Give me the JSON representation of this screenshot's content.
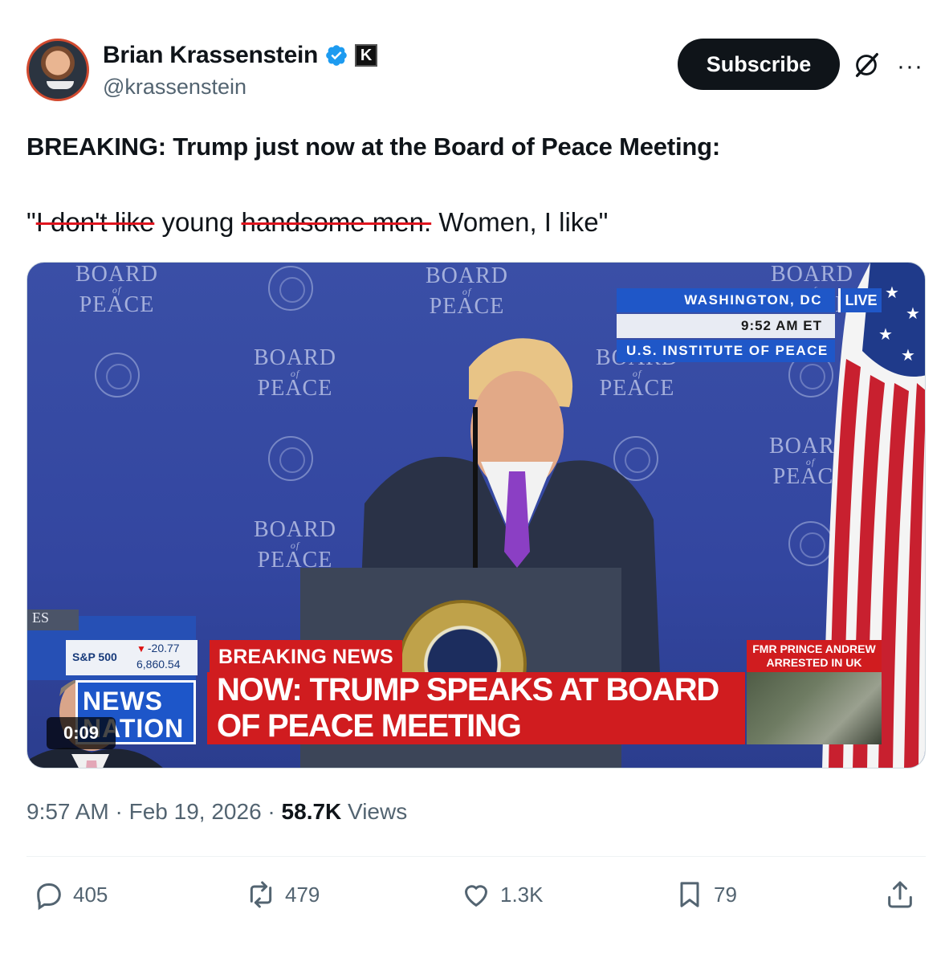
{
  "author": {
    "display_name": "Brian Krassenstein",
    "handle": "@krassenstein",
    "verified_badge_icon": "verified-checkmark-icon",
    "affiliate_badge_letter": "K"
  },
  "header": {
    "subscribe_label": "Subscribe",
    "grok_icon": "grok-icon",
    "more_icon": "more-options-icon"
  },
  "post": {
    "headline": "BREAKING: Trump just now at the Board of Peace Meeting:",
    "quote_open": "\"",
    "quote_struck_1": "I don't like",
    "quote_mid": " young ",
    "quote_struck_2": "handsome men.",
    "quote_end": " Women, I like\""
  },
  "video": {
    "timer": "0:09",
    "backdrop_text": {
      "board": "BOARD",
      "of": "of",
      "peace": "PEACE"
    },
    "live_bug": {
      "location": "WASHINGTON, DC",
      "live": "LIVE",
      "time": "9:52 AM ET",
      "venue": "U.S. INSTITUTE OF PEACE"
    },
    "ticker": {
      "index": "S&P 500",
      "change": "-20.77",
      "value": "6,860.54"
    },
    "network": "NEWS NATION",
    "breaking_label": "BREAKING NEWS",
    "banner": "NOW: TRUMP SPEAKS AT BOARD OF PEACE MEETING",
    "side_story": "FMR PRINCE ANDREW ARRESTED IN UK",
    "name_plate": "ES"
  },
  "meta": {
    "time": "9:57 AM",
    "sep": " · ",
    "date": "Feb 19, 2026",
    "views_count": "58.7K",
    "views_label": " Views"
  },
  "actions": {
    "replies": "405",
    "reposts": "479",
    "likes": "1.3K",
    "bookmarks": "79"
  },
  "colors": {
    "text": "#0f1419",
    "secondary": "#536471",
    "verified": "#1d9bf0",
    "strike": "#e0141e",
    "banner_red": "#d01c1f",
    "network_blue": "#1d56c9"
  }
}
